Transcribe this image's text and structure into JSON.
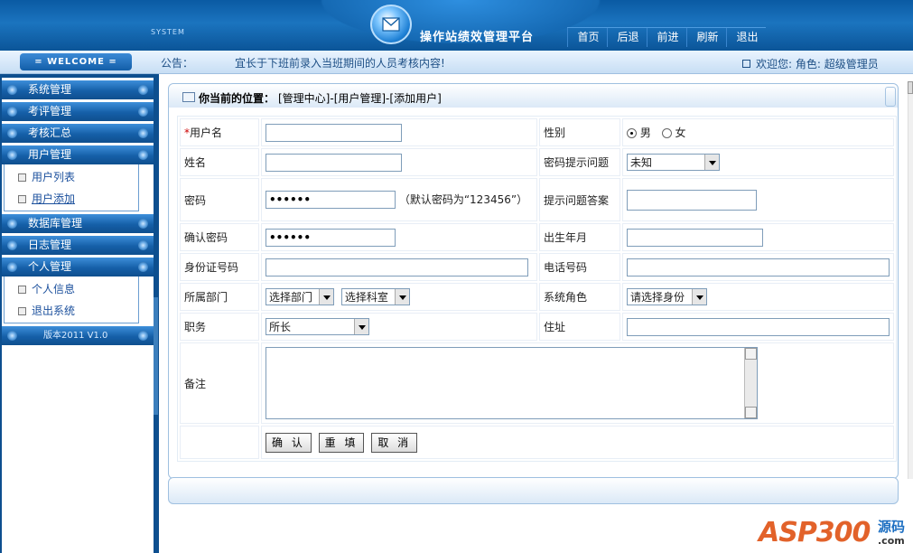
{
  "header": {
    "system_label": "SYSTEM",
    "app_title": "操作站绩效管理平台",
    "nav": [
      "首页",
      "后退",
      "前进",
      "刷新",
      "退出"
    ]
  },
  "bar": {
    "welcome": "= WELCOME =",
    "notice_label": "公告：",
    "notice_text": "宜长于下班前录入当班期间的人员考核内容!",
    "user_info": "欢迎您:  角色:  超级管理员"
  },
  "sidebar": {
    "menus": [
      {
        "label": "系统管理"
      },
      {
        "label": "考评管理"
      },
      {
        "label": "考核汇总"
      },
      {
        "label": "用户管理",
        "items": [
          "用户列表",
          "用户添加"
        ]
      },
      {
        "label": "数据库管理"
      },
      {
        "label": "日志管理"
      },
      {
        "label": "个人管理",
        "items": [
          "个人信息",
          "退出系统"
        ]
      }
    ],
    "version": "版本2011 V1.0"
  },
  "breadcrumb": {
    "label": "你当前的位置：",
    "path": "[管理中心]-[用户管理]-[添加用户]"
  },
  "form": {
    "username_label": "用户名",
    "gender_label": "性别",
    "gender_male": "男",
    "gender_female": "女",
    "name_label": "姓名",
    "hint_question_label": "密码提示问题",
    "hint_question_value": "未知",
    "password_label": "密码",
    "password_value": "••••••",
    "password_note": "（默认密码为“123456”）",
    "hint_answer_label": "提示问题答案",
    "confirm_label": "确认密码",
    "confirm_value": "••••••",
    "birth_label": "出生年月",
    "idcard_label": "身份证号码",
    "phone_label": "电话号码",
    "dept_label": "所属部门",
    "dept_value": "选择部门",
    "section_value": "选择科室",
    "role_label": "系统角色",
    "role_value": "请选择身份",
    "position_label": "职务",
    "position_value": "所长",
    "address_label": "住址",
    "remark_label": "备注"
  },
  "buttons": {
    "confirm": "确 认",
    "reset": "重 填",
    "cancel": "取 消"
  },
  "watermark": {
    "brand": "ASP300",
    "cn": "源码",
    "domain": ".com"
  },
  "colors": {
    "header_blue": "#1b74bf",
    "sidebar_blue": "#0d4f8f",
    "link_blue": "#1a4f9c",
    "required_red": "#cc0000",
    "watermark_orange": "#e2622a"
  }
}
